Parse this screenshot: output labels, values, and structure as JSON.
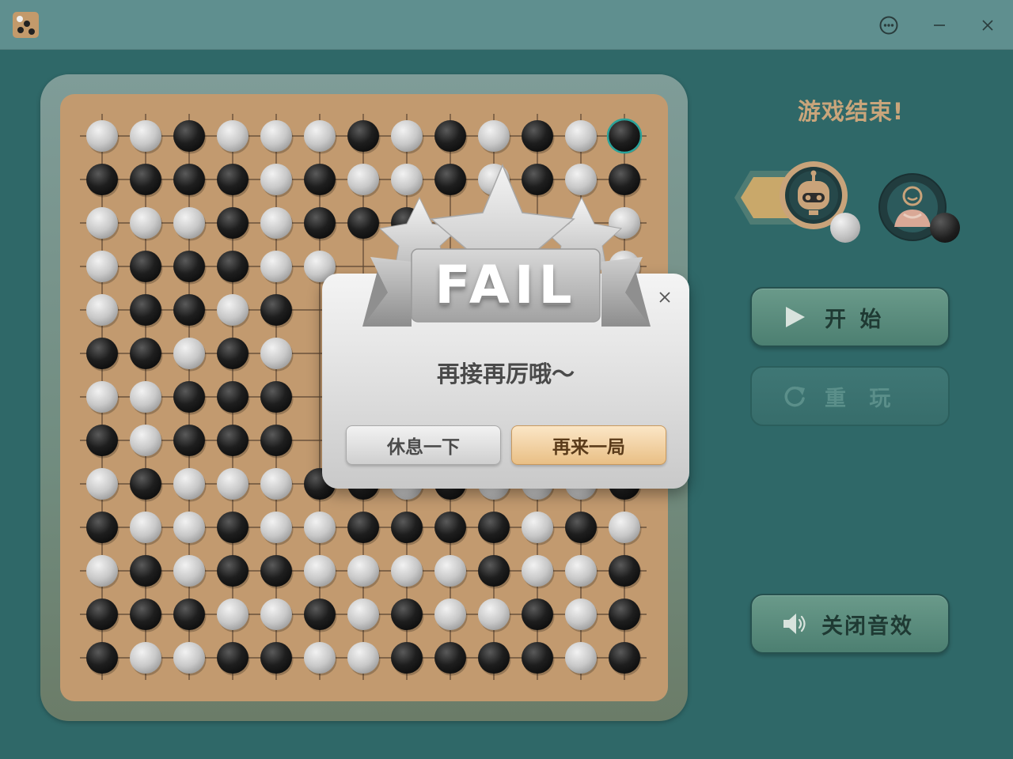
{
  "window": {
    "app_icon": "gomoku-board-icon",
    "controls": [
      {
        "name": "more-options-icon"
      },
      {
        "name": "minimize-icon"
      },
      {
        "name": "close-icon"
      }
    ]
  },
  "game": {
    "status_text": "游戏结束!",
    "board_size": 13,
    "last_move": {
      "row": 0,
      "col": 12
    },
    "board_rows": [
      "WWBWWWBWBWBWB",
      "BBBBWBWWBWBWB",
      "WWWBWBBB....W",
      "WBBBWW.....WW",
      "WBBWB.......W",
      "BBWBW........",
      "WWBBB........",
      "BWBBB........",
      "WBWWWBBWBWWWB",
      "BWWBWWBBBBWBW",
      "WBWBBWWWWBWWB",
      "BBBWWBWBWWBWB",
      "BWWBBWWBBBBWB"
    ],
    "colors": {
      "board_wood": "#c29a6f",
      "grid_line": "#5a4432",
      "black_stone": "#1e1e1e",
      "white_stone": "#c8c8c8",
      "last_move_ring": "#2aa39a"
    }
  },
  "players": [
    {
      "name": "robot-avatar",
      "role": "ai",
      "stone": "white",
      "active": true
    },
    {
      "name": "user-avatar",
      "role": "human",
      "stone": "black",
      "active": false
    }
  ],
  "buttons": {
    "start": {
      "label": "开 始",
      "icon": "play-icon",
      "enabled": true
    },
    "replay": {
      "label": "重 玩",
      "icon": "refresh-icon",
      "enabled": false
    },
    "sound": {
      "label": "关闭音效",
      "icon": "speaker-icon",
      "enabled": true
    }
  },
  "dialog": {
    "badge_text": "FAIL",
    "message": "再接再厉哦～",
    "rest_button": "休息一下",
    "again_button": "再来一局",
    "close_icon": "close-icon"
  }
}
